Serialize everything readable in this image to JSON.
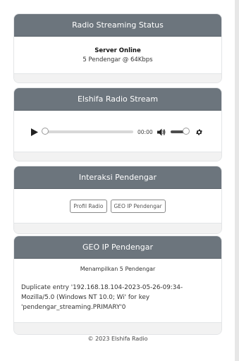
{
  "status": {
    "header": "Radio Streaming Status",
    "title": "Server Online",
    "detail": "5 Pendengar @ 64Kbps"
  },
  "stream": {
    "header": "Elshifa Radio Stream",
    "player": {
      "time": "00:00",
      "progress": 0,
      "volume": 0.8
    }
  },
  "interaction": {
    "header": "Interaksi Pendengar",
    "buttons": [
      "Profil Radio",
      "GEO IP Pendengar"
    ]
  },
  "geo": {
    "header": "GEO IP Pendengar",
    "count_text": "Menampilkan 5 Pendengar",
    "error_text": "Duplicate entry '192.168.18.104-2023-05-26-09:34-Mozilla/5.0 (Windows NT 10.0; Wi' for key 'pendengar_streaming.PRIMARY'0"
  },
  "footer": {
    "copyright": "© 2023 Elshifa Radio"
  },
  "colors": {
    "header_bg": "#6c757d",
    "footer_bg": "#f2f2f2"
  }
}
